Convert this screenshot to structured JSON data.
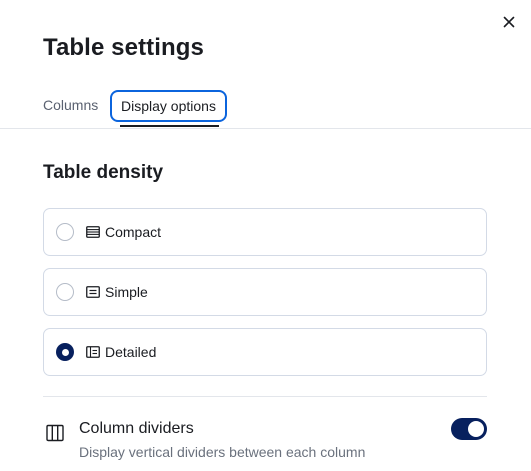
{
  "flyout": {
    "title": "Table settings",
    "close_icon": "close-icon"
  },
  "tabs": [
    {
      "label": "Columns",
      "selected": false
    },
    {
      "label": "Display options",
      "selected": true
    }
  ],
  "density": {
    "title": "Table density",
    "options": [
      {
        "label": "Compact",
        "icon": "rows-compact-icon",
        "checked": false
      },
      {
        "label": "Simple",
        "icon": "rows-simple-icon",
        "checked": false
      },
      {
        "label": "Detailed",
        "icon": "rows-detailed-icon",
        "checked": true
      }
    ]
  },
  "column_dividers": {
    "title": "Column dividers",
    "description": "Display vertical dividers between each column",
    "icon": "columns-icon",
    "enabled": true
  },
  "colors": {
    "accent": "#07205e",
    "focus": "#0b64dd",
    "border": "#d3dae6",
    "text": "#1a1c21",
    "muted_text": "#6a717d"
  }
}
